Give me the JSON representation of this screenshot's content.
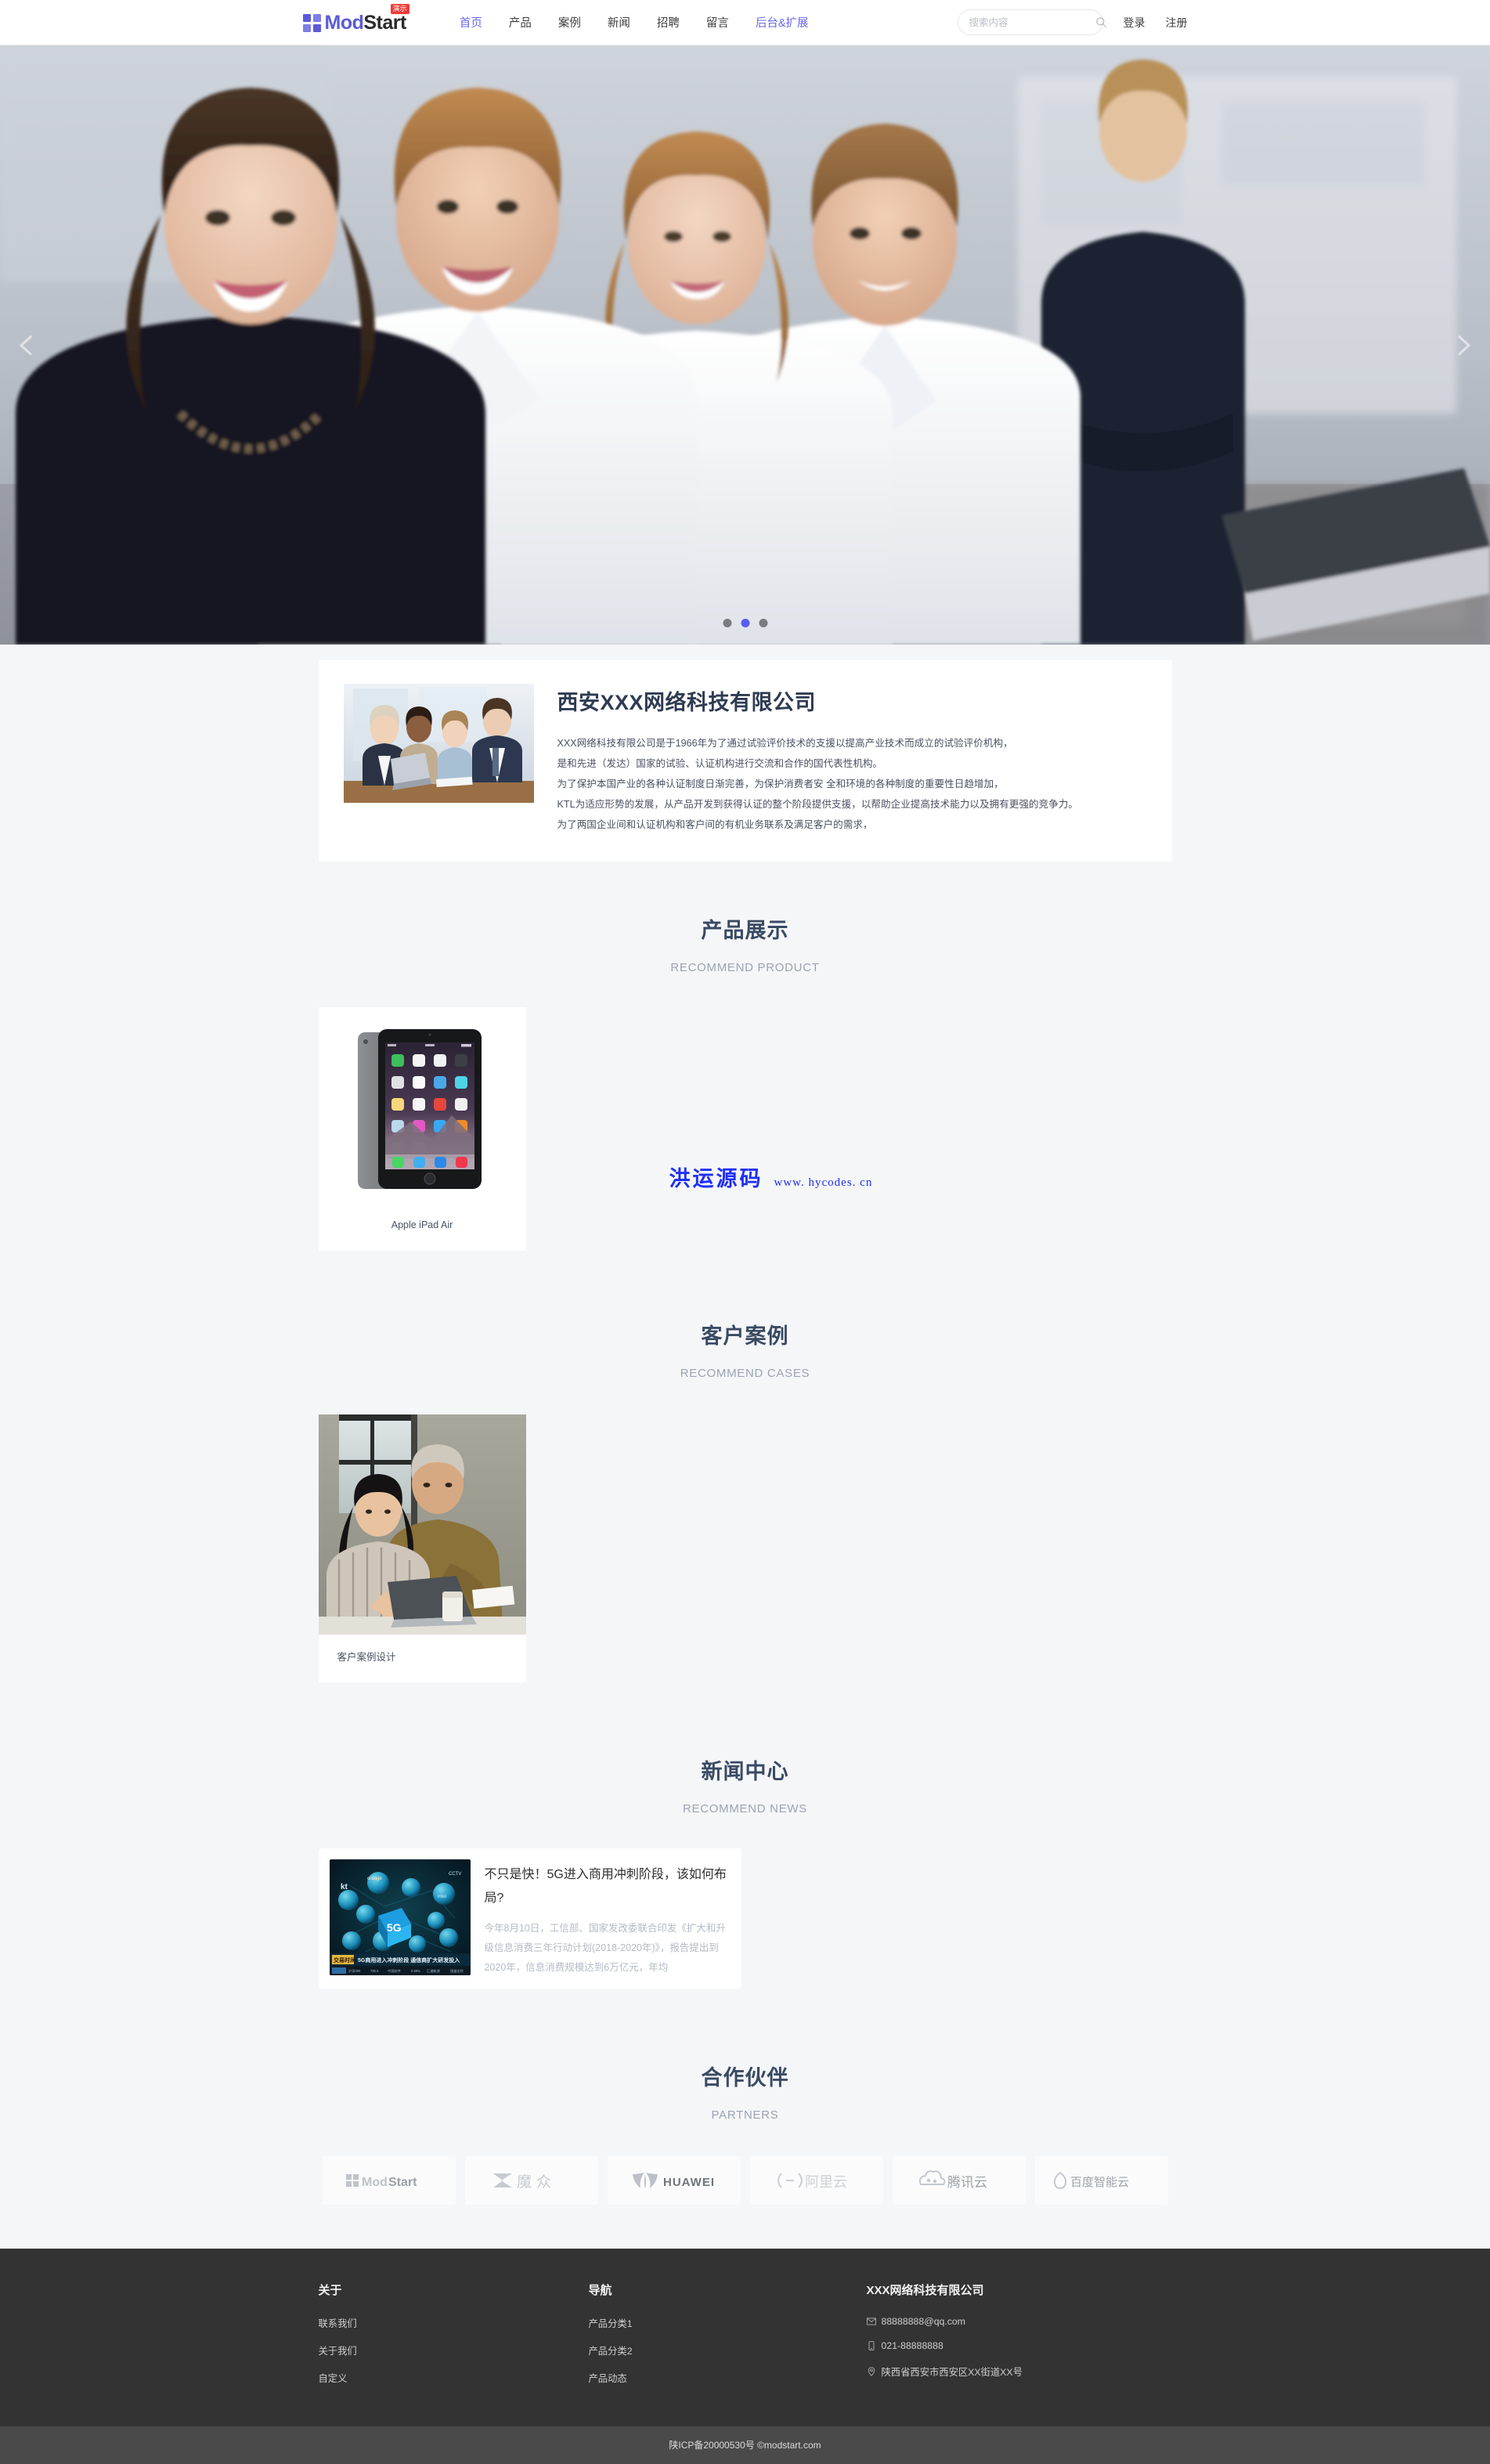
{
  "nav": {
    "brand": {
      "mod": "Mod",
      "start": "Start",
      "badge": "演示"
    },
    "links": [
      {
        "label": "首页",
        "accent": true
      },
      {
        "label": "产品",
        "accent": false
      },
      {
        "label": "案例",
        "accent": false
      },
      {
        "label": "新闻",
        "accent": false
      },
      {
        "label": "招聘",
        "accent": false
      },
      {
        "label": "留言",
        "accent": false
      },
      {
        "label": "后台&扩展",
        "accent": true
      }
    ],
    "search": {
      "placeholder": "搜索内容",
      "value": "",
      "icon": "search-icon"
    },
    "login": "登录",
    "register": "注册"
  },
  "hero": {
    "prev_icon": "chevron-left-icon",
    "next_icon": "chevron-right-icon",
    "dots": 3,
    "active_dot": 1
  },
  "intro": {
    "title": "西安XXX网络科技有限公司",
    "paragraphs": [
      "XXX网络科技有限公司是于1966年为了通过试验评价技术的支援以提高产业技术而成立的试验评价机构，",
      "是和先进（发达）国家的试验、认证机构进行交流和合作的国代表性机构。",
      "为了保护本国产业的各种认证制度日渐完善，为保护消费者安 全和环境的各种制度的重要性日趋增加，",
      "KTL为适应形势的发展，从产品开发到获得认证的整个阶段提供支援，以帮助企业提高技术能力以及拥有更强的竞争力。",
      "为了两国企业间和认证机构和客户间的有机业务联系及满足客户的需求，"
    ]
  },
  "sections": {
    "product": {
      "title": "产品展示",
      "subtitle": "RECOMMEND PRODUCT"
    },
    "cases": {
      "title": "客户案例",
      "subtitle": "RECOMMEND CASES"
    },
    "news": {
      "title": "新闻中心",
      "subtitle": "RECOMMEND NEWS"
    },
    "partners": {
      "title": "合作伙伴",
      "subtitle": "PARTNERS"
    }
  },
  "products": [
    {
      "name": "Apple iPad Air"
    }
  ],
  "cases": [
    {
      "name": "客户案例设计"
    }
  ],
  "news": [
    {
      "title": "不只是快！5G进入商用冲刺阶段，该如何布局?",
      "desc": "今年8月10日，工信部、国家发改委联合印发《扩大和升级信息消费三年行动计划(2018-2020年)》，报告提出到2020年，信息消费规模达到6万亿元，年均"
    }
  ],
  "partners": [
    {
      "name": "ModStart",
      "icon": "modstart-logo-icon"
    },
    {
      "name": "魔众",
      "icon": "mozhong-logo-icon"
    },
    {
      "name": "HUAWEI",
      "icon": "huawei-logo-icon"
    },
    {
      "name": "阿里云",
      "icon": "aliyun-logo-icon"
    },
    {
      "name": "腾讯云",
      "icon": "tencentcloud-logo-icon"
    },
    {
      "name": "百度智能云",
      "icon": "baiducloud-logo-icon"
    }
  ],
  "watermark": {
    "cn": "洪运源码",
    "url": "www. hycodes. cn"
  },
  "footer": {
    "about": {
      "title": "关于",
      "links": [
        "联系我们",
        "关于我们",
        "自定义"
      ]
    },
    "navcol": {
      "title": "导航",
      "links": [
        "产品分类1",
        "产品分类2",
        "产品动态"
      ]
    },
    "contact": {
      "title": "XXX网络科技有限公司",
      "email": "88888888@qq.com",
      "phone": "021-88888888",
      "address": "陕西省西安市西安区XX街道XX号",
      "email_icon": "mail-icon",
      "phone_icon": "phone-icon",
      "address_icon": "location-pin-icon"
    },
    "copyright": "陕ICP备20000530号 ©modstart.com"
  },
  "colors": {
    "accent": "#6868e8",
    "brand_purple": "#5b5bd6",
    "badge_red": "#ef3b36",
    "page_bg": "#f5f6f8",
    "footer_bg": "#333333",
    "copyright_bg": "#4a4a4a",
    "heading": "#3a4a63",
    "subheading": "#9aa3b4"
  }
}
